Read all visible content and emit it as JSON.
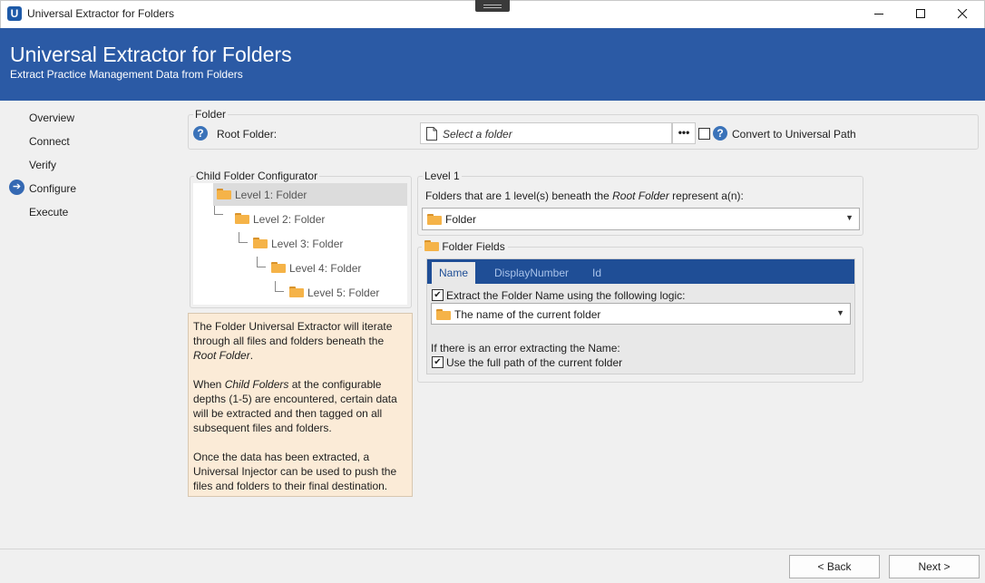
{
  "window": {
    "title": "Universal Extractor for Folders",
    "app_icon_letter": "U"
  },
  "banner": {
    "title": "Universal Extractor for Folders",
    "subtitle": "Extract Practice Management Data from Folders"
  },
  "nav": {
    "items": [
      "Overview",
      "Connect",
      "Verify",
      "Configure",
      "Execute"
    ],
    "active": "Configure"
  },
  "folder_group": {
    "label": "Folder",
    "root_folder_label": "Root Folder:",
    "root_folder_placeholder": "Select a folder",
    "browse_label": "•••",
    "convert_label": "Convert to Universal Path",
    "convert_checked": false
  },
  "child_config": {
    "label": "Child Folder Configurator",
    "levels": [
      "Level 1: Folder",
      "Level 2: Folder",
      "Level 3: Folder",
      "Level 4: Folder",
      "Level 5: Folder"
    ],
    "selected": "Level 1: Folder"
  },
  "info": {
    "p1_a": "The Folder Universal Extractor will iterate through all files and folders beneath the ",
    "p1_em": "Root Folder",
    "p1_b": ".",
    "p2_a": "When ",
    "p2_em": "Child Folders",
    "p2_b": " at the configurable depths (1-5) are encountered, certain data will be extracted and then tagged on all subsequent files and folders.",
    "p3": "Once the data has been extracted, a Universal Injector can be used to push the files and folders to their final destination."
  },
  "level": {
    "label": "Level 1",
    "desc_a": "Folders that are 1 level(s) beneath the ",
    "desc_em": "Root Folder",
    "desc_b": " represent a(n):",
    "type_value": "Folder"
  },
  "fields": {
    "label": "Folder Fields",
    "tabs": [
      "Name",
      "DisplayNumber",
      "Id"
    ],
    "active_tab": "Name",
    "extract_label": "Extract the Folder Name using the following logic:",
    "extract_checked": true,
    "logic_value": "The name of the current folder",
    "error_label": "If there is an error extracting the Name:",
    "fallback_label": "Use the full path of the current folder",
    "fallback_checked": true
  },
  "footer": {
    "back_label": "< Back",
    "next_label": "Next >"
  },
  "colors": {
    "banner": "#2b5aa5",
    "tab_header": "#1f4e96",
    "info_bg": "#fbebd7"
  }
}
